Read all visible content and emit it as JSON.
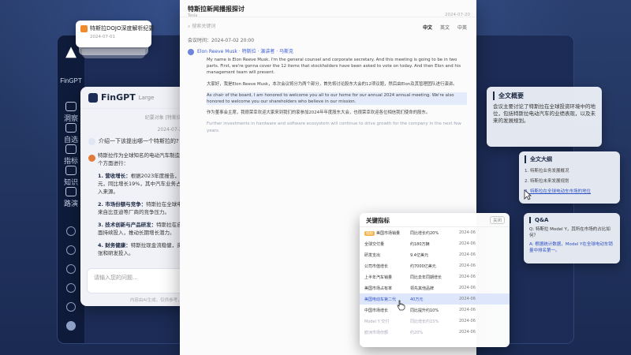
{
  "app": {
    "name": "FinGPT",
    "nav": [
      {
        "label": "洞察"
      },
      {
        "label": "自选"
      },
      {
        "label": "指标"
      },
      {
        "label": "知识"
      },
      {
        "label": "路演"
      }
    ]
  },
  "toast": {
    "title": "特斯拉DOJO深度解析纪要",
    "time": "2024-07-01"
  },
  "chat": {
    "title": "FinGPT",
    "subtitle": "Large",
    "system_note": "纪要对象 [特斯拉股东会]",
    "date": "2024-07-20",
    "question": "介绍一下该提出哪一个特斯拉的?",
    "answer_intro": "特斯拉作为全球知名的电动汽车制造商，其未来的业绩可以从以下几个方面进行：",
    "answer_items": [
      {
        "title": "1. 营收增长：",
        "text": "根据2023年度报告，特斯拉全年营收达约968亿美元，同比增长19%，其中汽车业务占比超过80%，依然是公司主要收入来源。"
      },
      {
        "title": "2. 市场份额与竞争：",
        "text": "特斯拉在全球电动车市场占据领先地位，但面临来自比亚迪等厂商的竞争压力。"
      },
      {
        "title": "3. 技术创新与产品研发：",
        "text": "特斯拉在自动驾驶、电池技术和能源业务方面持续投入，推动长期增长潜力。"
      },
      {
        "title": "4. 财务健康：",
        "text": "特斯拉现金流稳健，资本开支合理，能够支撑新工厂扩张和研发投入。"
      }
    ],
    "input_placeholder": "请输入您的问题...",
    "footer": "内容由AI生成，仅供参考，不构成投资建议"
  },
  "doc": {
    "title": "特斯拉新闻播报探讨",
    "subtitle": "Tesla",
    "time": "2024-07-20",
    "search_placeholder": "搜索关键词",
    "tabs": [
      "中文",
      "英文",
      "中英"
    ],
    "meta": "会议时间：2024-07-02 20:00",
    "speaker": "Elon Reeve Musk · 特斯拉 · 演讲者 · 马斯克",
    "paragraphs": [
      "My name is Elon Reeve Musk. I'm the general counsel and corporate secretary. And this meeting is going to be in two parts. First, we're gonna cover the 12 items that stockholders have been asked to vote on today. And then Elon and his management team will present.",
      "大家好，我是Elon Reeve Musk，本次会议将分为两个部分，首先将讨论股东大会的12项议题，然后由Elon及其管理团队进行演讲。",
      "As chair of the board, I am honored to welcome you all to our home for our annual 2024 annual meeting. We're also honored to welcome you our shareholders who believe in our mission.",
      "作为董事会主席，我很荣幸欢迎大家来到我们的家参加2024年年度股东大会，也很荣幸欢迎各位相信我们使命的股东。",
      "Further investments in hardware and software ecosystem will continue to drive growth for the company in the next few years."
    ]
  },
  "summary": {
    "label": "全文概要",
    "text": "会议主要讨论了特斯拉在全球投资环境中的地位，包括特斯拉电动汽车的业绩表现，以及未来的发展规划。"
  },
  "outline": {
    "label": "全文大纲",
    "items": [
      "1. 特斯拉业务发展概况",
      "2. 特斯拉未来发展规划",
      "3. 特斯拉在全球电动车市场的地位"
    ]
  },
  "qa": {
    "label": "Q&A",
    "question": "Q: 特斯拉 Model Y，其所在市场的占比如何？",
    "answer": "A: 根据统计数据，Model Y在全球电动车销量中排名第一。"
  },
  "kpi": {
    "title": "关键指标",
    "close_label": "关闭",
    "rows": [
      {
        "name": "美国市场销量",
        "value": "同比增长约20%",
        "date": "2024-06",
        "badge": "指标"
      },
      {
        "name": "全球交付量",
        "value": "约180万辆",
        "date": "2024-06",
        "badge": ""
      },
      {
        "name": "研发支出",
        "value": "9.4亿美元",
        "date": "2024-06",
        "badge": ""
      },
      {
        "name": "公司市值增长",
        "value": "约7000亿美元",
        "date": "2024-06",
        "badge": ""
      },
      {
        "name": "上半年汽车销量",
        "value": "同比去年同期增长",
        "date": "2024-06",
        "badge": ""
      },
      {
        "name": "美国市场占有率",
        "value": "领先其他品牌",
        "date": "2024-06",
        "badge": ""
      },
      {
        "name": "美国电动车第二代",
        "value": "40万元",
        "date": "2024-06",
        "badge": ""
      },
      {
        "name": "中国市场增长",
        "value": "同比提升约10%",
        "date": "2024-06",
        "badge": ""
      },
      {
        "name": "Model Y 交付",
        "value": "同比增长约15%",
        "date": "2024-06",
        "badge": ""
      },
      {
        "name": "欧洲市场份额",
        "value": "约20%",
        "date": "2024-06",
        "badge": ""
      }
    ]
  }
}
